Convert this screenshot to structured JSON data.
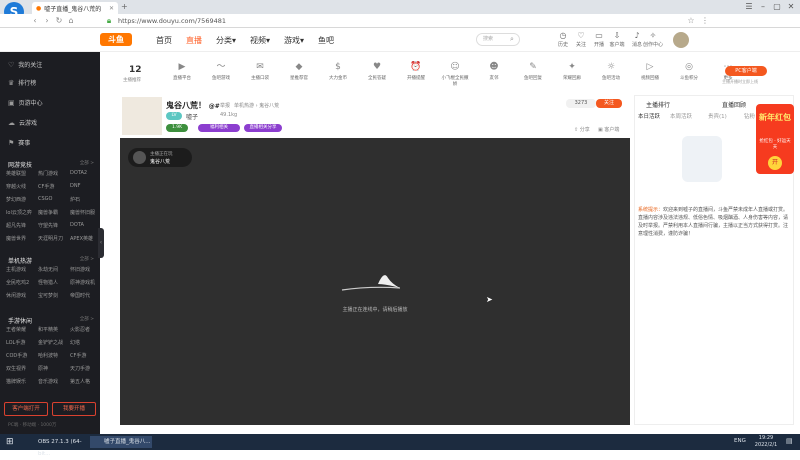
{
  "browser": {
    "tab_title": "嘘子直播_鬼谷八荒的",
    "url": "https://www.douyu.com/7569481",
    "logo_letter": "S"
  },
  "site": {
    "logo_text": "斗鱼",
    "nav": [
      "首页",
      "直播",
      "分类▾",
      "视频▾",
      "游戏▾",
      "鱼吧"
    ],
    "search_placeholder": "搜索",
    "header_icons": [
      "历史",
      "关注",
      "开播",
      "客户端",
      "消息",
      "创作中心"
    ],
    "brand_color": "#ff5d23"
  },
  "sidebar": {
    "items": [
      {
        "icon": "♡",
        "label": "我的关注"
      },
      {
        "icon": "♛",
        "label": "排行榜"
      },
      {
        "icon": "▣",
        "label": "页游中心"
      },
      {
        "icon": "☁",
        "label": "云游戏"
      },
      {
        "icon": "⚑",
        "label": "赛事"
      }
    ],
    "sections": [
      {
        "title": "网游竞技",
        "more": "全部 >",
        "games": [
          "英雄联盟",
          "热门游戏",
          "DOTA2",
          "穿越火线",
          "CF手游",
          "DNF",
          "梦幻西游",
          "CSGO",
          "炉石",
          "lol云顶之弈",
          "魔兽争霸",
          "魔兽怀旧服",
          "超凡先锋",
          "守望先锋",
          "DOTA",
          "魔兽世界",
          "天涯明月刀",
          "APEX英雄"
        ]
      },
      {
        "title": "单机热游",
        "more": "全部 >",
        "games": [
          "主机游戏",
          "永劫无间",
          "怀旧游戏",
          "全民吃鸡2",
          "怪物猎人",
          "原神游戏机",
          "休闲游戏",
          "宝可梦剑",
          "帝国时代"
        ]
      },
      {
        "title": "手游休闲",
        "more": "全部 >",
        "games": [
          "王者荣耀",
          "和平精英",
          "火影忍者",
          "LOL手游",
          "金铲铲之战",
          "幻塔",
          "COD手游",
          "哈利波特",
          "CF手游",
          "双生视界",
          "原神",
          "天刀手游",
          "猫牌娱乐",
          "音乐游戏",
          "第五人格"
        ]
      }
    ],
    "btn_client": "客户端打开",
    "btn_start": "我要开播",
    "footer": "PC端 · 移动端 · 1000万"
  },
  "category_strip": {
    "count": "12",
    "count_label": "主播推荐",
    "items": [
      "直播平台",
      "鱼吧游戏",
      "主播口袋",
      "星推荐官",
      "大力金币",
      "全民答疑",
      "开播提醒",
      "小飞棍全民撒娇",
      "友邻",
      "鱼吧回复",
      "荣耀回廊",
      "鱼吧活动",
      "视频回播",
      "斗鱼积分",
      "更多"
    ],
    "pc_badge": "PC客户端",
    "pc_sub": "主播开播时立即上线"
  },
  "room": {
    "title": "鬼谷八荒！",
    "suffix": "@#",
    "meta": [
      "举报",
      "单机热游 › 鬼谷八荒"
    ],
    "streamer": "嘘子",
    "hot": "49.1kg",
    "tags": [
      "1.9K",
      "福利相关",
      "直播相关分享"
    ],
    "follow_count": "3273",
    "follow_label": "关注",
    "share": "分享",
    "screenshot": "客户端"
  },
  "video": {
    "tag_line1": "主播正在玩",
    "tag_line2": "鬼谷八荒",
    "loading": "主播正在连线中，请稍后播放",
    "bg": "#2f2f2f"
  },
  "chat": {
    "top_tabs": [
      "主播排行",
      "直播回顾"
    ],
    "tabs": [
      "本日活跃",
      "本周活跃",
      "贵宾(1)",
      "钻粉"
    ],
    "promo_title": "新年红包",
    "promo_sub": "抢红包 · 好运天天",
    "promo_btn": "开",
    "notice_label": "系统提示：",
    "notice": "欢迎来到嘘子的直播间，斗鱼严禁未成年人直播或打赏。直播内容涉及违法违规、低俗色情、吸烟酗酒、人身伤害等内容，请及时举报。严禁利用本人直播间行骗，主播以正当方式获得打赏。注意理性消费，谨防诈骗！"
  },
  "taskbar": {
    "apps": [
      "OBS 27.1.3 (64-bit...",
      "嘘子直播_鬼谷八..."
    ],
    "tray_lang": "ENG",
    "time": "19:29",
    "date": "2022/2/1"
  }
}
